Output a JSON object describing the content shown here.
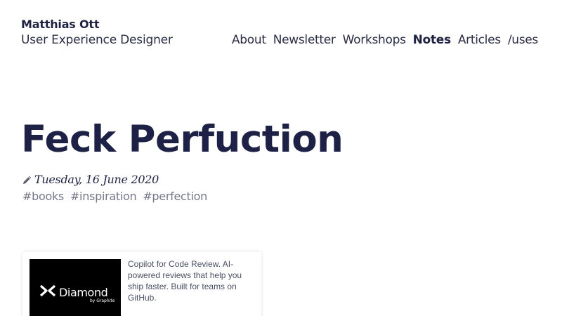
{
  "header": {
    "site_name": "Matthias Ott",
    "site_role": "User Experience Designer"
  },
  "nav": {
    "items": [
      {
        "label": "About",
        "active": false
      },
      {
        "label": "Newsletter",
        "active": false
      },
      {
        "label": "Workshops",
        "active": false
      },
      {
        "label": "Notes",
        "active": true
      },
      {
        "label": "Articles",
        "active": false
      },
      {
        "label": "/uses",
        "active": false
      }
    ]
  },
  "article": {
    "title": "Feck Perfuction",
    "date": "Tuesday, 16 June 2020",
    "date_icon": "pencil-icon",
    "tags": [
      "#books",
      "#inspiration",
      "#perfection"
    ]
  },
  "ad": {
    "brand": "Diamond",
    "brand_sub": "by Graphite",
    "logo_icon": "diamond-x-icon",
    "text": "Copilot for Code Review. AI-powered reviews that help you ship faster. Built for teams on GitHub."
  },
  "colors": {
    "text_dark": "#1c2145",
    "tag_gray": "#75778a",
    "ad_bg": "#000000"
  }
}
